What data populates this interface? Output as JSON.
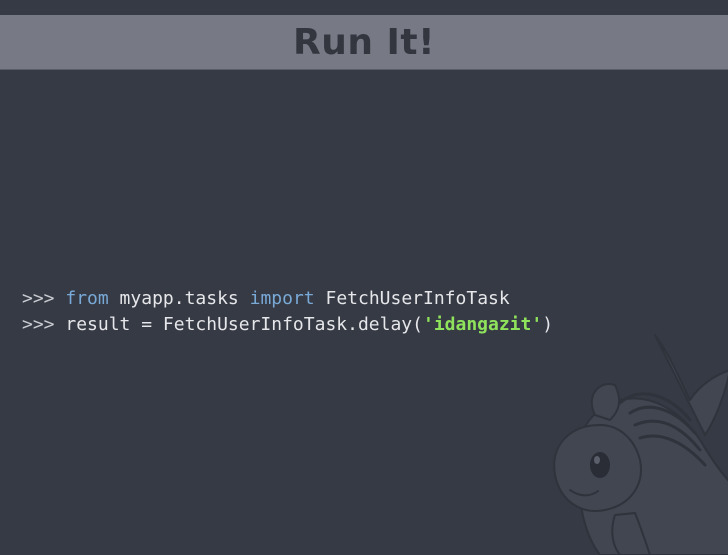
{
  "slide": {
    "title": "Run It!"
  },
  "code": {
    "line1": {
      "prompt": ">>> ",
      "kw_from": "from",
      "module": " myapp.tasks ",
      "kw_import": "import",
      "name": " FetchUserInfoTask"
    },
    "line2": {
      "prompt": ">>> ",
      "expr": "result = FetchUserInfoTask.delay(",
      "arg": "'idangazit'",
      "close": ")"
    }
  },
  "mascot": {
    "icon": "pony-mascot-icon"
  },
  "colors": {
    "background": "#363a44",
    "title_band": "#777a84",
    "keyword": "#79a9d6",
    "string": "#8fe25c"
  }
}
